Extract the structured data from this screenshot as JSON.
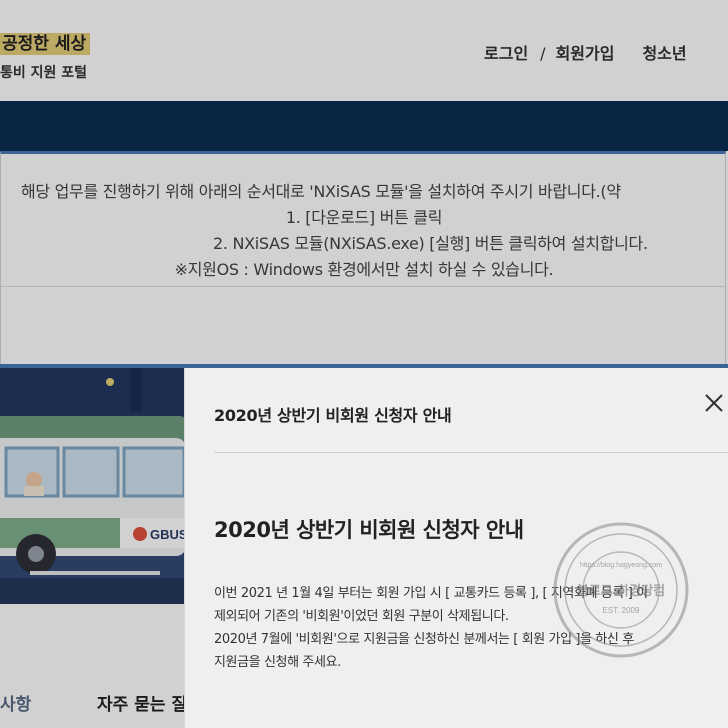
{
  "header": {
    "logo_title": "공정한 세상",
    "logo_subtitle": "통비 지원 포털",
    "nav": {
      "login": "로그인",
      "separator": "/",
      "signup": "회원가입",
      "youth": "청소년"
    }
  },
  "notice": {
    "line1": "해당 업무를 진행하기 위해 아래의 순서대로 'NXiSAS 모듈'을 설치하여 주시기 바랍니다.(약",
    "line2": "1. [다운로드] 버튼 클릭",
    "line3": "2. NXiSAS 모듈(NXiSAS.exe) [실행] 버튼 클릭하여 설치합니다.",
    "line4": "※지원OS : Windows 환경에서만 설치 하실 수 있습니다."
  },
  "banner": {
    "bus_label": "GBUS"
  },
  "tabs": {
    "notice": "사항",
    "faq": "자주 묻는 질"
  },
  "modal": {
    "header_title": "2020년 상반기 비회원 신청자 안내",
    "title": "2020년 상반기 비회원 신청자 안내",
    "body": [
      "이번 2021 년 1월 4일 부터는 회원 가입 시 [ 교통카드 등록 ], [ 지역화폐 등록 ] 이",
      "제외되어 기존의 '비회원'이었던 회원 구분이 삭제됩니다.",
      "2020년 7월에 '비회원'으로 지원금을 신청하신 분께서는 [ 회원 가입 ]을 하신 후",
      "지원금을 신청해 주세요."
    ]
  },
  "watermark": {
    "text": "블로그 하경당컴",
    "url": "https://blog.hagyeong.com",
    "year": "EST. 2009"
  },
  "colors": {
    "navbar": "#0d2e52",
    "accent_blue": "#4a79b8",
    "logo_highlight": "#e6cf7a",
    "modal_bg": "#efefef"
  }
}
